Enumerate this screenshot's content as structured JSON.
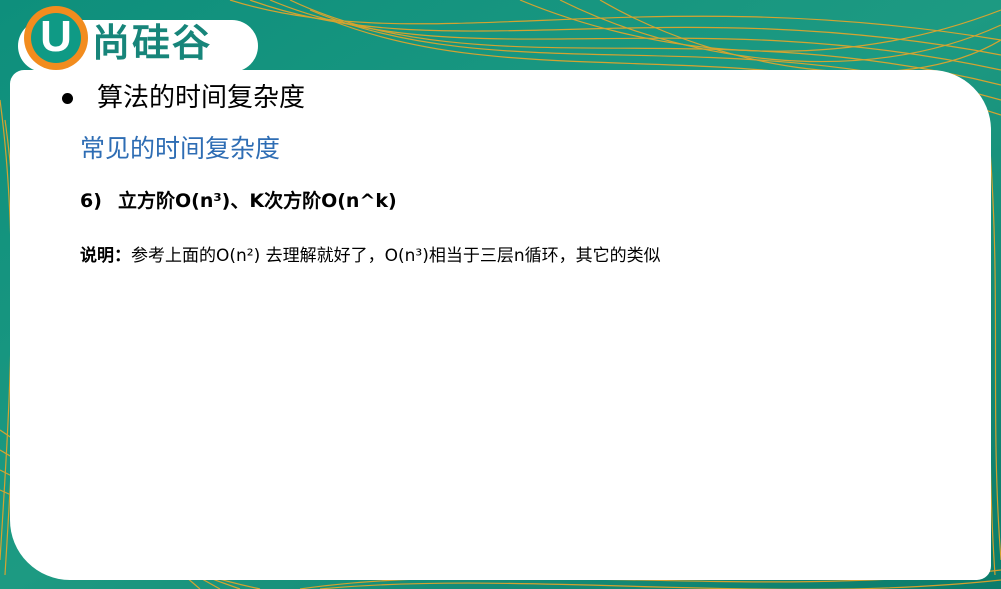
{
  "brand": {
    "logo_letter": "U",
    "logo_text": "尚硅谷",
    "colors": {
      "teal": "#17857a",
      "orange": "#f28c1e",
      "blue_heading": "#2e6db4"
    }
  },
  "slide": {
    "heading": "算法的时间复杂度",
    "subheading": "常见的时间复杂度",
    "item": {
      "number": "6)",
      "text": "立方阶O(n³)、K次方阶O(n^k)"
    },
    "note": {
      "label": "说明：",
      "text": "参考上面的O(n²) 去理解就好了，O(n³)相当于三层n循环，其它的类似"
    }
  }
}
